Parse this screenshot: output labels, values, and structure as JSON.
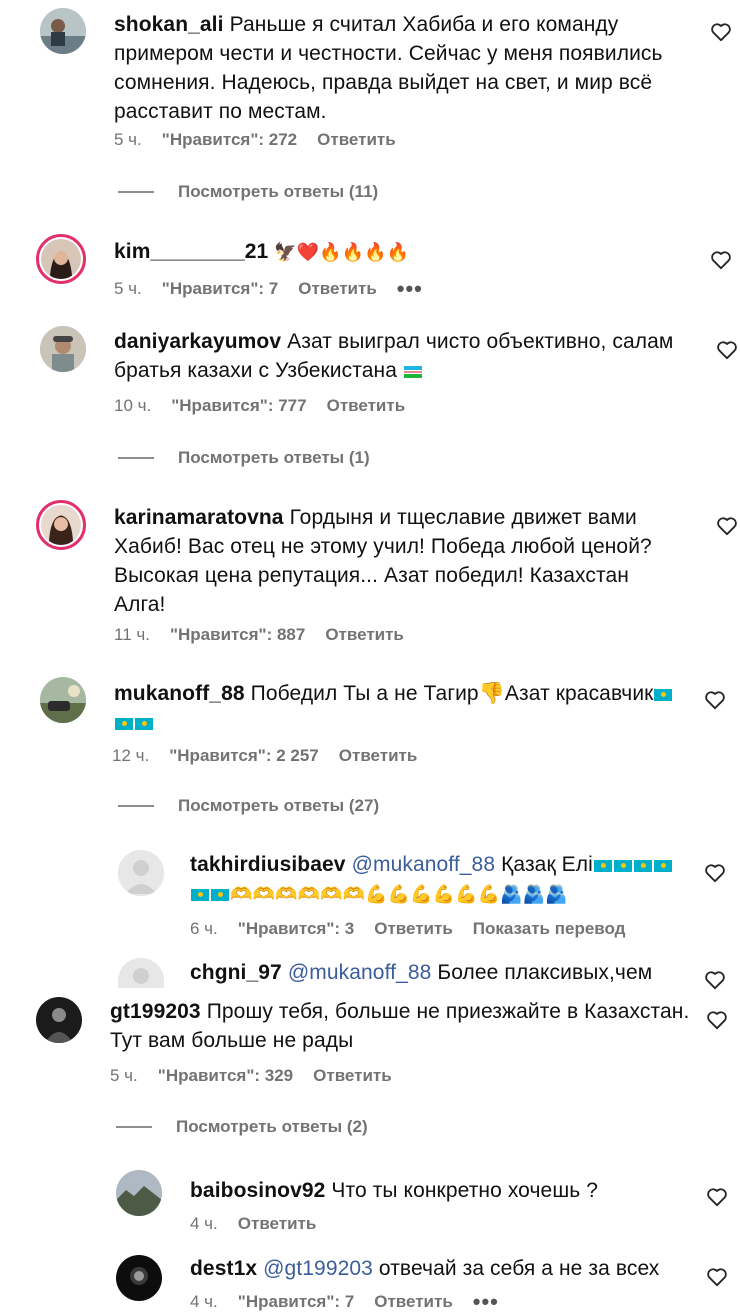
{
  "comments": [
    {
      "username": "shokan_ali",
      "text": "Раньше я считал Хабиба и его команду примером чести и честности. Сейчас у меня появились сомнения. Надеюсь, правда выйдет на свет, и мир всё расставит по местам.",
      "time": "5 ч.",
      "likes": "\"Нравится\": 272",
      "reply": "Ответить",
      "view_replies": "Посмотреть ответы (11)"
    },
    {
      "username": "kim________21",
      "text": "🦅❤️🔥🔥🔥🔥",
      "time": "5 ч.",
      "likes": "\"Нравится\": 7",
      "reply": "Ответить",
      "more": "•••"
    },
    {
      "username": "daniyarkayumov",
      "text": "Азат выиграл чисто объективно, салам братья казахи с Узбекистана",
      "time": "10 ч.",
      "likes": "\"Нравится\": 777",
      "reply": "Ответить",
      "view_replies": "Посмотреть ответы (1)"
    },
    {
      "username": "karinamaratovna",
      "text": "Гордыня и тщеславие движет вами Хабиб! Вас отец не этому учил! Победа любой ценой? Высокая цена репутация... Азат победил! Казахстан Алга!",
      "time": "11 ч.",
      "likes": "\"Нравится\": 887",
      "reply": "Ответить"
    },
    {
      "username": "mukanoff_88",
      "text": "Победил Ты а не Тагир👎Азат красавчик",
      "time": "12 ч.",
      "likes": "\"Нравится\": 2 257",
      "reply": "Ответить",
      "view_replies": "Посмотреть ответы (27)"
    },
    {
      "username": "takhirdiusibaev",
      "mention": "@mukanoff_88",
      "text": "Қазақ Елі",
      "emoji_tail": "🫶🫶🫶🫶🫶🫶💪💪💪💪💪💪🫂🫂🫂",
      "time": "6 ч.",
      "likes": "\"Нравится\": 3",
      "reply": "Ответить",
      "translate": "Показать перевод"
    },
    {
      "username": "chgni_97",
      "mention": "@mukanoff_88",
      "text": "Более плаксивых,чем"
    },
    {
      "username": "gt199203",
      "text": "Прошу тебя, больше не приезжайте в Казахстан. Тут вам больше не рады",
      "time": "5 ч.",
      "likes": "\"Нравится\": 329",
      "reply": "Ответить",
      "view_replies": "Посмотреть ответы (2)"
    },
    {
      "username": "baibosinov92",
      "text": "Что ты конкретно хочешь ?",
      "time": "4 ч.",
      "reply": "Ответить"
    },
    {
      "username": "dest1x",
      "mention": "@gt199203",
      "text": "отвечай за себя а не за всех",
      "time": "4 ч.",
      "likes": "\"Нравится\": 7",
      "reply": "Ответить",
      "more": "•••"
    }
  ],
  "colors": {
    "meta": "#737373",
    "mention": "#3b5d9c",
    "story_ring": "#e1306c"
  },
  "icons": {
    "like": "heart-outline-icon",
    "more": "more-dots-icon"
  }
}
